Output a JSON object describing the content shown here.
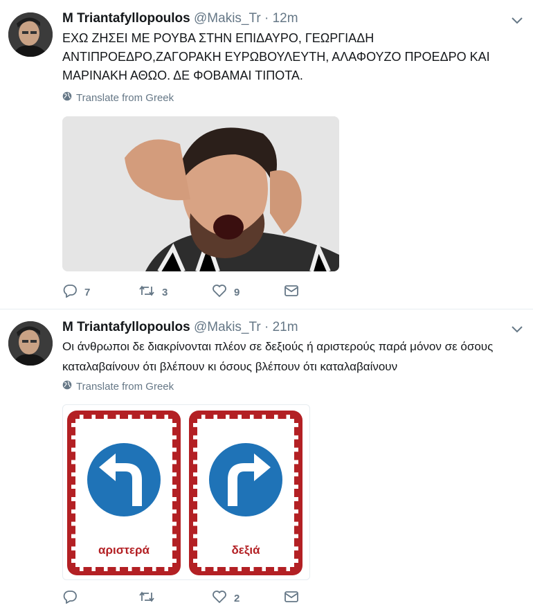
{
  "tweets": [
    {
      "name": "M Triantafyllopoulos",
      "handle": "@Makis_Tr",
      "separator": "·",
      "time": "12m",
      "text": "ΕΧΩ ΖΗΣΕΙ ΜΕ ΡΟΥΒΑ ΣΤΗΝ ΕΠΙΔΑΥΡΟ, ΓΕΩΡΓΙΑΔΗ ΑΝΤΙΠΡΟΕΔΡΟ,ΖΑΓΟΡΑΚΗ ΕΥΡΩΒΟΥΛΕΥΤΗ, ΑΛΑΦΟΥΖΟ ΠΡΟΕΔΡΟ ΚΑΙ ΜΑΡΙΝΑΚΗ ΑΘΩΟ. ΔΕ ΦΟΒΑΜΑΙ ΤΙΠΟΤΑ.",
      "translate": "Translate from Greek",
      "replies": "7",
      "retweets": "3",
      "likes": "9"
    },
    {
      "name": "M Triantafyllopoulos",
      "handle": "@Makis_Tr",
      "separator": "·",
      "time": "21m",
      "text": "Οι άνθρωποι δε διακρίνονται πλέον σε δεξιούς ή αριστερούς παρά μόνον σε όσους  καταλαβαίνουν ότι βλέπουν κι όσους  βλέπουν ότι καταλαβαίνουν",
      "translate": "Translate from Greek",
      "replies": "",
      "retweets": "",
      "likes": "2",
      "sign_left": "αριστερά",
      "sign_right": "δεξιά"
    }
  ],
  "colors": {
    "accent": "#1da1f2",
    "sign_red": "#b32024",
    "sign_blue": "#1f73b7",
    "muted": "#657786"
  },
  "icons": [
    "reply-icon",
    "retweet-icon",
    "like-icon",
    "dm-icon",
    "globe-icon",
    "chevron-down-icon"
  ]
}
